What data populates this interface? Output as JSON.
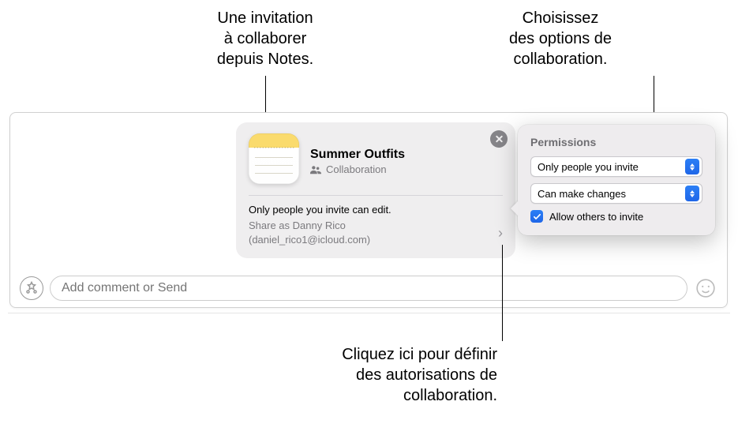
{
  "callouts": {
    "top_left": "Une invitation\nà collaborer\ndepuis Notes.",
    "top_right": "Choisissez\ndes options de\ncollaboration.",
    "bottom": "Cliquez ici pour définir\ndes autorisations de\ncollaboration."
  },
  "compose": {
    "placeholder": "Add comment or Send"
  },
  "card": {
    "title": "Summer Outfits",
    "subtitle": "Collaboration",
    "permission_summary": "Only people you invite can edit.",
    "share_as_line1": "Share as Danny Rico",
    "share_as_line2": "(daniel_rico1@icloud.com)"
  },
  "popover": {
    "title": "Permissions",
    "who_select": "Only people you invite",
    "access_select": "Can make changes",
    "allow_invite_label": "Allow others to invite",
    "allow_invite_checked": true
  }
}
